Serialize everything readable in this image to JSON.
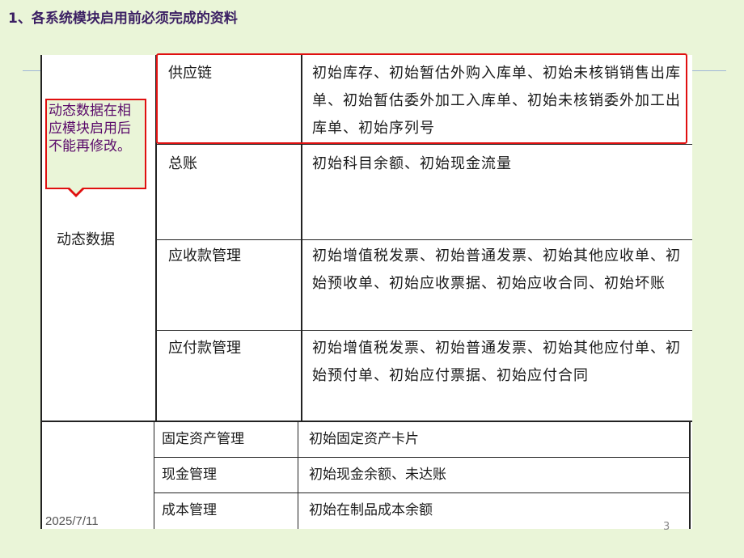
{
  "title": "1、各系统模块启用前必须完成的资料",
  "callout": "动态数据在相应模块启用后不能再修改。",
  "group_label": "动态数据",
  "rows": [
    {
      "module": "供应链",
      "content": "初始库存、初始暂估外购入库单、初始未核销销售出库单、初始暂估委外加工入库单、初始未核销委外加工出库单、初始序列号"
    },
    {
      "module": "总账",
      "content": "初始科目余额、初始现金流量"
    },
    {
      "module": "应收款管理",
      "content": "初始增值税发票、初始普通发票、初始其他应收单、初始预收单、初始应收票据、初始应收合同、初始坏账"
    },
    {
      "module": "应付款管理",
      "content": "初始增值税发票、初始普通发票、初始其他应付单、初始预付单、初始应付票据、初始应付合同"
    }
  ],
  "rows2": [
    {
      "module": "固定资产管理",
      "content": "初始固定资产卡片"
    },
    {
      "module": "现金管理",
      "content": "初始现金余额、未达账"
    },
    {
      "module": "成本管理",
      "content": "初始在制品成本余额"
    }
  ],
  "footer_date": "2025/7/11",
  "page_number": "3"
}
